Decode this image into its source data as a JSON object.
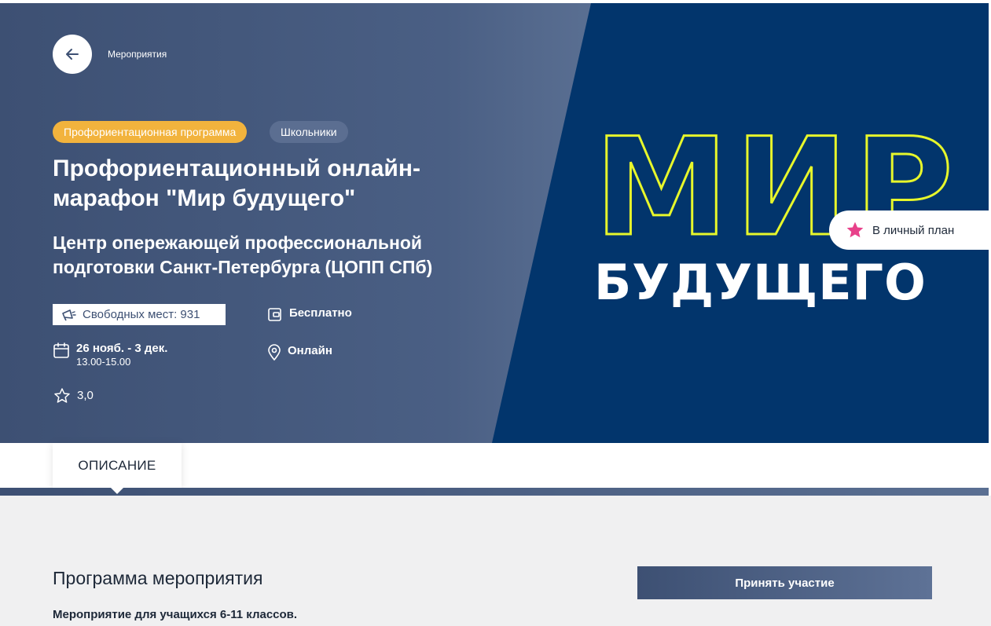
{
  "hero": {
    "back_label": "Мероприятия",
    "tags": [
      "Профориентационная программа",
      "Школьники"
    ],
    "title": "Профориентационный онлайн-марафон \"Мир будущего\"",
    "organizer": "Центр опережающей профессиональной подготовки Санкт-Петербурга (ЦОПП СПб)",
    "seats": "Свободных мест: 931",
    "price": "Бесплатно",
    "date": "26 нояб. - 3 дек.",
    "time": "13.00-15.00",
    "format": "Онлайн",
    "rating": "3,0",
    "plan_button": "В личный план"
  },
  "banner": {
    "line1": "МИР",
    "line2": "БУДУЩЕГО"
  },
  "tabs": {
    "active": "ОПИСАНИЕ"
  },
  "program": {
    "title": "Программа мероприятия",
    "text": "Мероприятие для учащихся 6-11 классов.",
    "join_button": "Принять участие"
  },
  "colors": {
    "hero_bg": "#4a5f84",
    "banner_bg": "#02356c",
    "neon_yellow": "#e7f72b",
    "tag_orange": "#f2b33d",
    "star_pink": "#e8418a"
  },
  "icons": {
    "back": "arrow-left-icon",
    "seats": "megaphone-icon",
    "price": "wallet-icon",
    "date": "calendar-icon",
    "format": "location-pin-icon",
    "rating": "star-outline-icon",
    "plan": "star-filled-icon"
  }
}
